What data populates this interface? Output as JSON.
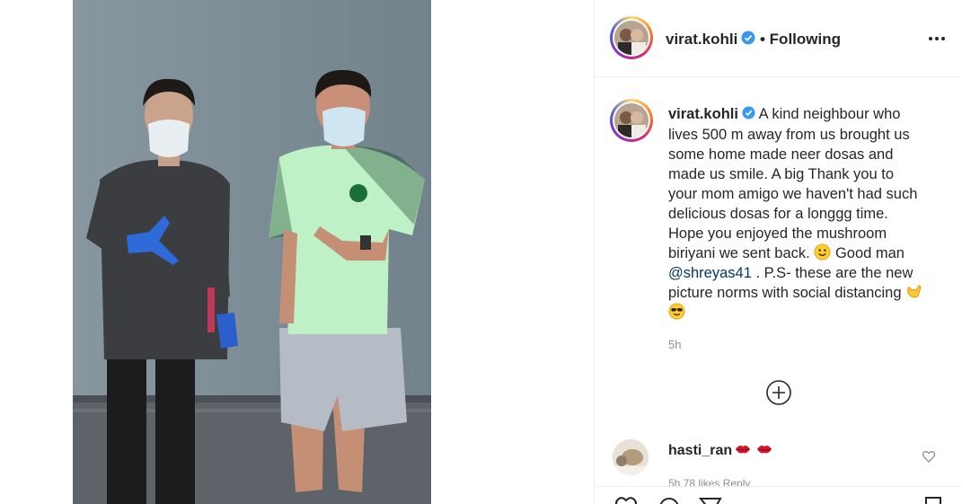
{
  "post": {
    "author": "virat.kohli",
    "follow_status": "• Following",
    "image_alt": "Two men wearing face masks standing apart in front of a grey wall"
  },
  "caption": {
    "author": "virat.kohli",
    "lines": [
      "A kind neighbour who",
      "lives 500 m away from us brought us",
      "some home made neer dosas and",
      "made us smile. A big Thank you to",
      "your mom amigo we haven't had such",
      "delicious dosas for a longgg time.",
      "Hope you enjoyed the mushroom",
      "biriyani we sent back."
    ],
    "after_smile": "Good man",
    "mention": "@shreyas41",
    "after_mention": ". P.S- these are the new",
    "last_line": "picture norms with social distancing",
    "timestamp": "5h"
  },
  "comments": [
    {
      "user": "hasti_ran",
      "emoji": [
        "kiss-mark",
        "kiss-mark"
      ],
      "meta": "5h   78 likes   Reply"
    }
  ],
  "icons": {
    "verified": "verified-badge-icon",
    "more": "more-options-icon",
    "load_more": "plus-circle-icon",
    "like": "heart-icon"
  },
  "colors": {
    "verified_blue": "#3897f0",
    "mention": "#00376b",
    "muted": "#8e8e8e",
    "jersey_green": "#b9f0c0"
  }
}
